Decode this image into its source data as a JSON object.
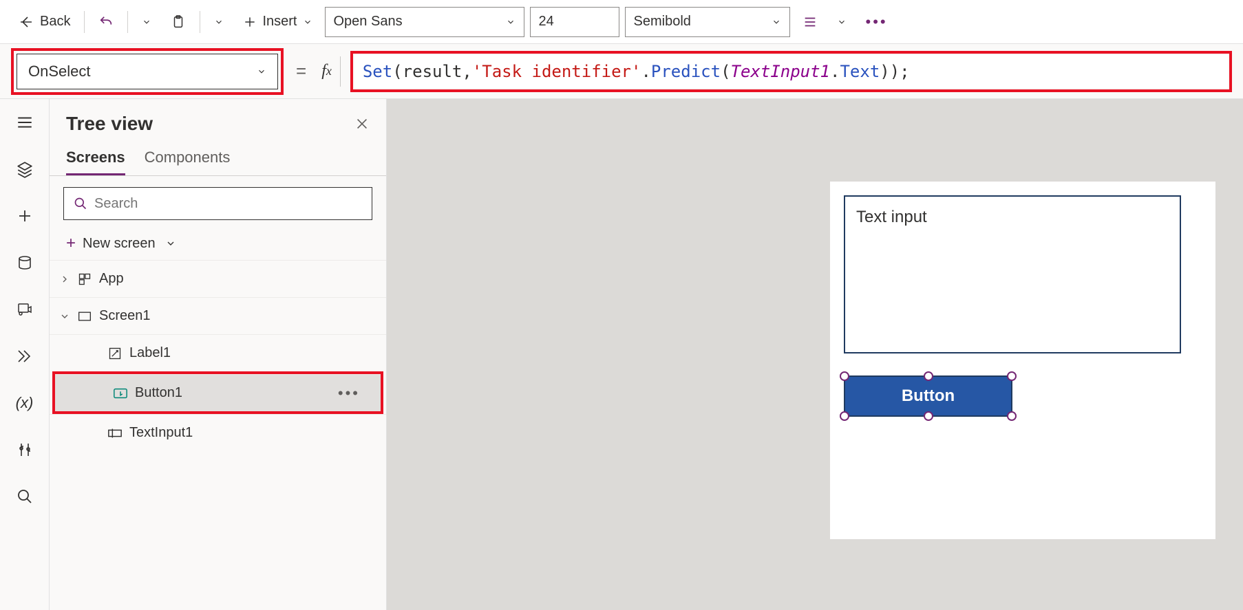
{
  "toolbar": {
    "back_label": "Back",
    "insert_label": "Insert",
    "font_family": "Open Sans",
    "font_size": "24",
    "font_weight": "Semibold"
  },
  "formula": {
    "property": "OnSelect",
    "tokens": {
      "set": "Set",
      "open1": "(result, ",
      "str": "'Task identifier'",
      "dot1": ".",
      "predict": "Predict",
      "open2": "(",
      "ti": "TextInput1",
      "dot2": ".",
      "text": "Text",
      "close": "));"
    }
  },
  "tree": {
    "title": "Tree view",
    "tab_screens": "Screens",
    "tab_components": "Components",
    "search_placeholder": "Search",
    "new_screen": "New screen",
    "app": "App",
    "screen1": "Screen1",
    "label1": "Label1",
    "button1": "Button1",
    "textinput1": "TextInput1"
  },
  "canvas": {
    "text_input_value": "Text input",
    "button_label": "Button"
  }
}
